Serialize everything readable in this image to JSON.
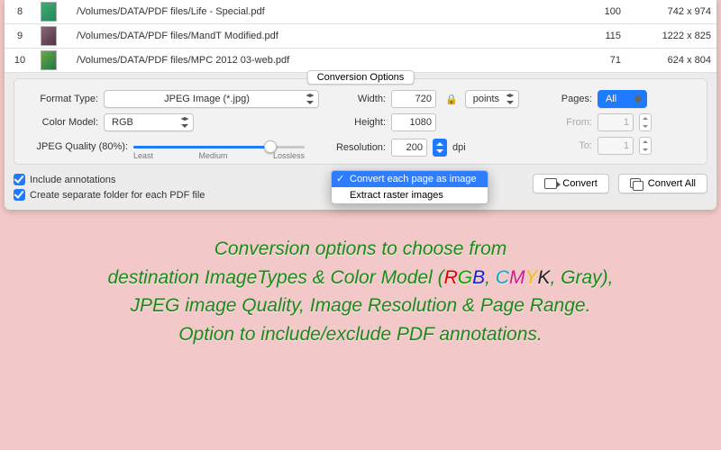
{
  "files": [
    {
      "index": 8,
      "path": "/Volumes/DATA/PDF files/Life - Special.pdf",
      "pages": 100,
      "dimensions": "742 x 974"
    },
    {
      "index": 9,
      "path": "/Volumes/DATA/PDF files/MandT Modified.pdf",
      "pages": 115,
      "dimensions": "1222 x 825"
    },
    {
      "index": 10,
      "path": "/Volumes/DATA/PDF files/MPC 2012 03-web.pdf",
      "pages": 71,
      "dimensions": "624 x 804"
    }
  ],
  "options": {
    "legend": "Conversion Options",
    "format_label": "Format Type:",
    "format_value": "JPEG Image (*.jpg)",
    "color_label": "Color Model:",
    "color_value": "RGB",
    "quality_label": "JPEG Quality (80%):",
    "quality_pct": 80,
    "slider_least": "Least",
    "slider_medium": "Medium",
    "slider_lossless": "Lossless",
    "width_label": "Width:",
    "width_value": "720",
    "height_label": "Height:",
    "height_value": "1080",
    "units_value": "points",
    "resolution_label": "Resolution:",
    "resolution_value": "200",
    "dpi": "dpi",
    "pages_label": "Pages:",
    "pages_value": "All",
    "from_label": "From:",
    "from_value": "1",
    "to_label": "To:",
    "to_value": "1"
  },
  "bottom": {
    "include_annotations": "Include annotations",
    "separate_folder": "Create separate folder for each PDF file",
    "mode_dropdown": {
      "selected": "Convert each page as image",
      "other": "Extract raster images"
    },
    "convert": "Convert",
    "convert_all": "Convert All"
  },
  "promo": {
    "l1": "Conversion options to choose from",
    "l2a": "destination ImageTypes & Color Model (",
    "l2b": ", Gray),",
    "l3": "JPEG image Quality, Image Resolution & Page Range.",
    "l4": "Option to include/exclude PDF annotations."
  }
}
